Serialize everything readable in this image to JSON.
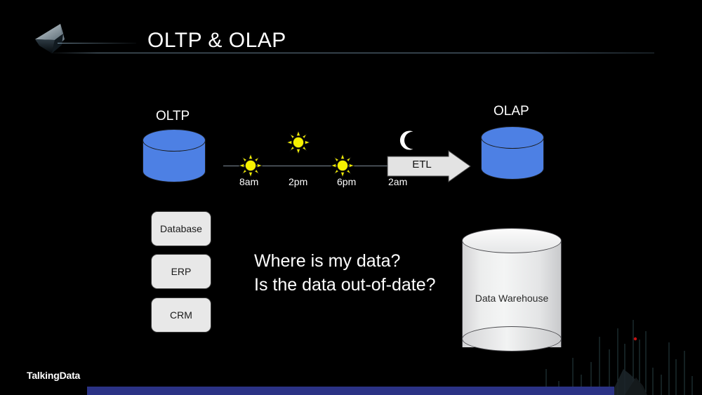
{
  "header": {
    "title": "OLTP & OLAP",
    "logo_icon": "paper-plane-logo"
  },
  "diagram": {
    "oltp_label": "OLTP",
    "olap_label": "OLAP",
    "warehouse_label": "Data Warehouse",
    "etl_label": "ETL",
    "timeline": [
      {
        "icon": "sun-icon",
        "label": "8am"
      },
      {
        "icon": "sun-icon",
        "label": "2pm"
      },
      {
        "icon": "sun-icon",
        "label": "6pm"
      },
      {
        "icon": "moon-icon",
        "label": "2am"
      }
    ],
    "sources": [
      {
        "label": "Database"
      },
      {
        "label": "ERP"
      },
      {
        "label": "CRM"
      }
    ],
    "questions": {
      "line1": "Where is my data?",
      "line2": "Is the data out-of-date?"
    }
  },
  "footer": {
    "wordmark": "TalkingData"
  },
  "colors": {
    "background": "#000000",
    "database_blue": "#4d80e4",
    "warehouse_gray": "#eceded",
    "source_box_gray": "#e8e8e8",
    "sun_yellow": "#f5f000",
    "moon_white": "#ffffff",
    "footer_bar_blue": "#2b3285",
    "title_text": "#ffffff"
  }
}
